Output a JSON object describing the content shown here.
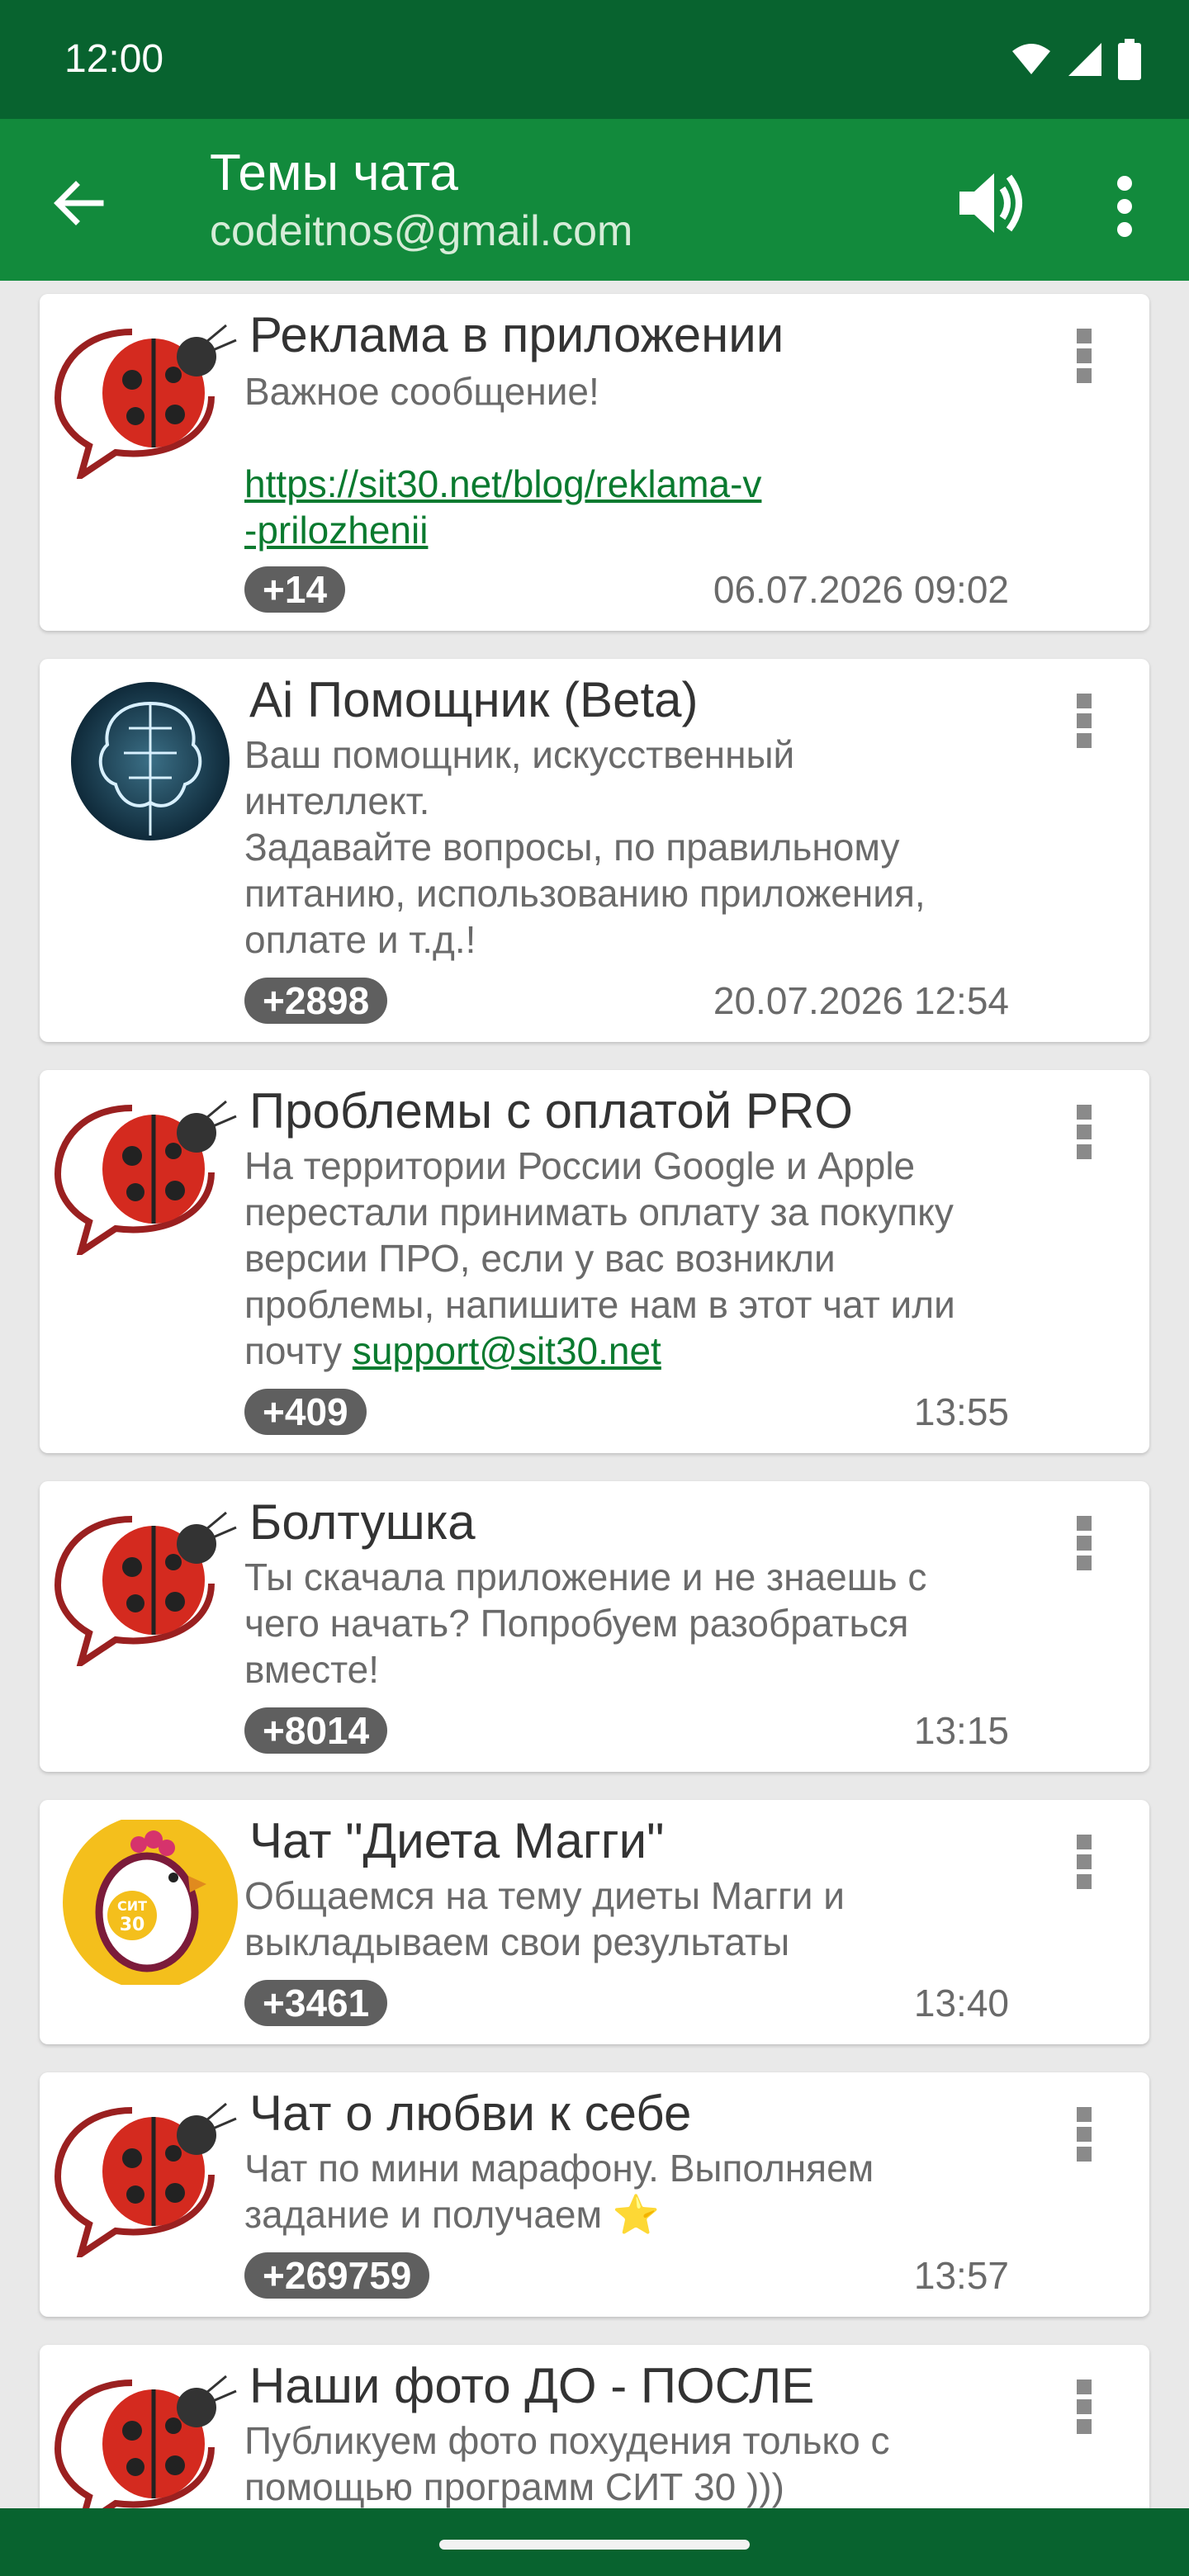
{
  "status_bar": {
    "time": "12:00"
  },
  "app_bar": {
    "title": "Темы чата",
    "subtitle": "codeitnos@gmail.com"
  },
  "colors": {
    "status_bar": "#08632f",
    "app_bar": "#128a3c",
    "link": "#0a7a2f",
    "badge": "#5f5f5f"
  },
  "chats": [
    {
      "avatar": "ladybug-speech-bubble-icon",
      "title": "Реклама в приложении",
      "lines": [
        "Важное сообщение!",
        ""
      ],
      "link_lines": [
        "https://sit30.net/blog/reklama-v",
        "-prilozhenii"
      ],
      "badge": "+14",
      "time": "06.07.2026 09:02"
    },
    {
      "avatar": "ai-brain-icon",
      "title": "Ai Помощник (Beta)",
      "lines": [
        "Ваш помощник, искусственный",
        "интеллект.",
        "Задавайте вопросы, по правильному",
        "питанию, использованию приложения,",
        "оплате и т.д.!"
      ],
      "badge": "+2898",
      "time": "20.07.2026 12:54"
    },
    {
      "avatar": "ladybug-speech-bubble-icon",
      "title": "Проблемы с оплатой PRO",
      "lines": [
        "На территории России Google и Apple",
        "перестали принимать оплату за покупку",
        "версии ПРО, если у вас возникли",
        "проблемы, напишите нам в этот чат или"
      ],
      "last_line_prefix": "почту ",
      "last_line_link": "support@sit30.net",
      "badge": "+409",
      "time": "13:55"
    },
    {
      "avatar": "ladybug-speech-bubble-icon",
      "title": "Болтушка",
      "lines": [
        "Ты скачала приложение и не знаешь с",
        "чего начать? Попробуем разобраться",
        "вместе!"
      ],
      "badge": "+8014",
      "time": "13:15"
    },
    {
      "avatar": "sit30-chicken-icon",
      "title": "Чат \"Диета Магги\"",
      "lines": [
        "Общаемся на тему диеты Магги и",
        "выкладываем свои результаты"
      ],
      "badge": "+3461",
      "time": "13:40"
    },
    {
      "avatar": "ladybug-speech-bubble-icon",
      "title": "Чат о любви к себе",
      "lines": [
        "Чат по мини марафону. Выполняем",
        "задание и получаем ⭐"
      ],
      "badge": "+269759",
      "time": "13:57"
    },
    {
      "avatar": "ladybug-speech-bubble-icon",
      "title": "Наши фото ДО - ПОСЛЕ",
      "lines": [
        "Публикуем фото похудения только с",
        "помощью программ СИТ 30 )))"
      ],
      "badge": "",
      "time": ""
    }
  ]
}
